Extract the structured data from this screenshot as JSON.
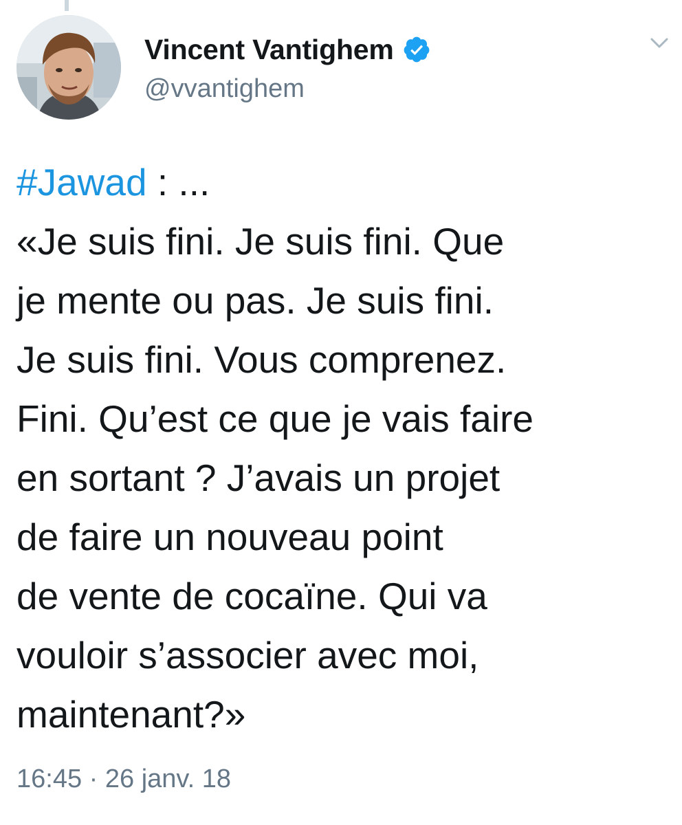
{
  "tweet": {
    "author": {
      "display_name": "Vincent Vantighem",
      "handle": "@vvantighem",
      "verified": true,
      "avatar_icon": "profile-photo"
    },
    "menu_icon": "chevron-down-icon",
    "hashtag": "#Jawad",
    "hashtag_suffix": " : ...",
    "body_lines": [
      "«Je suis fini. Je suis fini. Que",
      "je mente ou pas. Je suis fini.",
      "Je suis fini. Vous comprenez.",
      "Fini. Qu’est ce que je vais faire",
      "en sortant ? J’avais un projet",
      "de faire un nouveau point",
      "de vente de cocaïne. Qui va",
      "vouloir s’associer avec moi,",
      "maintenant?»"
    ],
    "time": "16:45",
    "separator": " · ",
    "date": "26 janv. 18"
  },
  "colors": {
    "link": "#1b95e0",
    "verified_badge": "#1da1f2",
    "secondary_text": "#657786",
    "primary_text": "#14171a"
  }
}
